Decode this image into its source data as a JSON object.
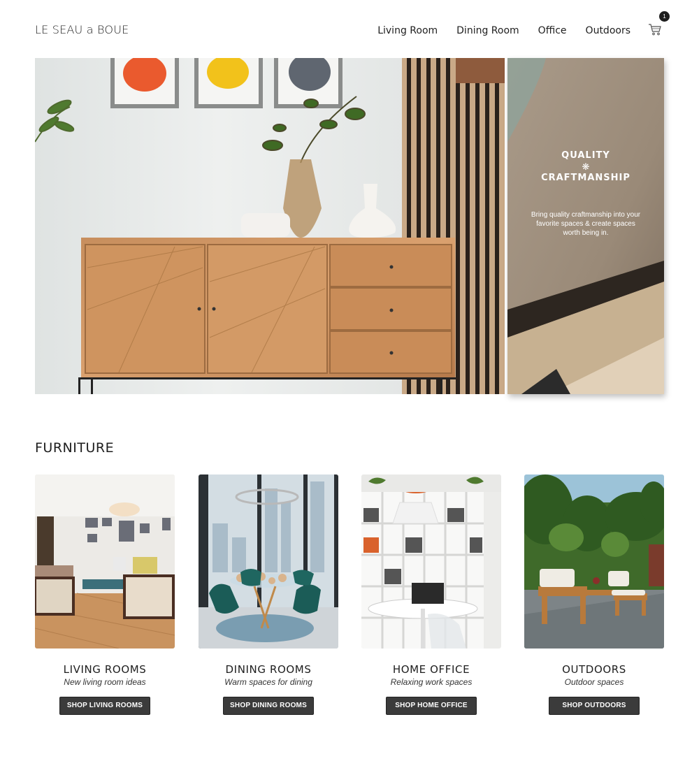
{
  "header": {
    "logo": "LE SEAU a BOUE",
    "nav": [
      "Living Room",
      "Dining Room",
      "Office",
      "Outdoors"
    ],
    "cart_count": "1",
    "cart_icon": "cart-icon"
  },
  "promo": {
    "title_line1": "QUALITY",
    "star": "❋",
    "title_line2": "CRAFTMANSHIP",
    "body": "Bring quality craftmanship into your favorite spaces & create spaces worth being in."
  },
  "furniture": {
    "title": "FURNITURE",
    "cards": [
      {
        "title": "LIVING ROOMS",
        "subtitle": "New living room ideas",
        "button": "SHOP LIVING ROOMS"
      },
      {
        "title": "DINING ROOMS",
        "subtitle": "Warm spaces for dining",
        "button": "SHOP DINING ROOMS"
      },
      {
        "title": "HOME OFFICE",
        "subtitle": "Relaxing work spaces",
        "button": "SHOP HOME OFFICE"
      },
      {
        "title": "OUTDOORS",
        "subtitle": "Outdoor spaces",
        "button": "SHOP OUTDOORS"
      }
    ]
  }
}
